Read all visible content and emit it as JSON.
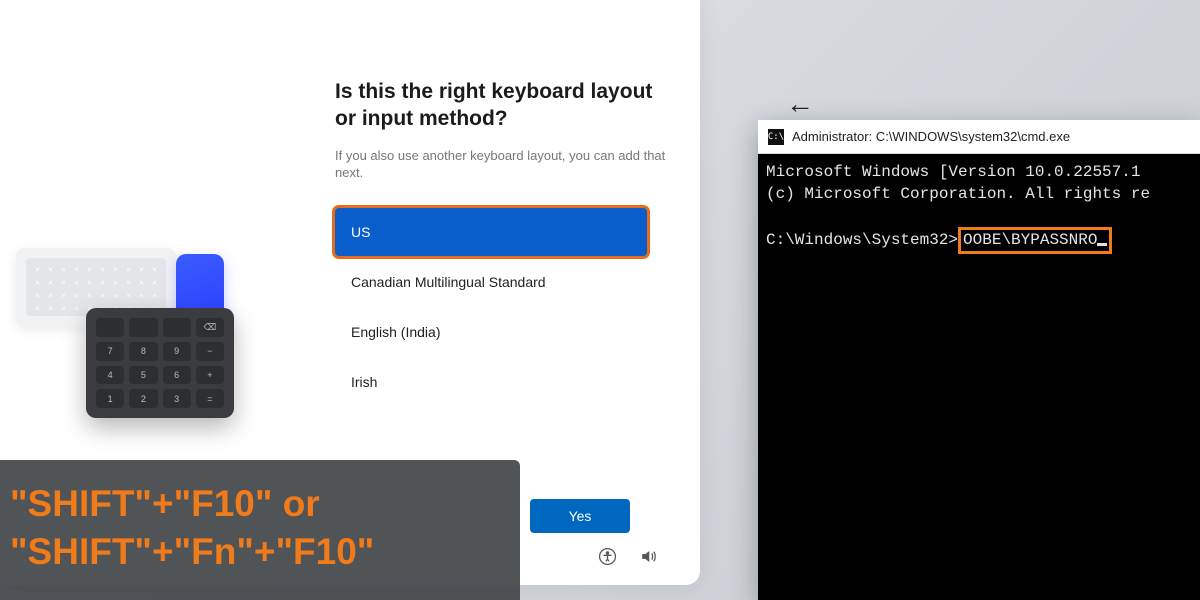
{
  "oobe": {
    "title": "Is this the right keyboard layout or input method?",
    "subtitle": "If you also use another keyboard layout, you can add that next.",
    "layouts": [
      "US",
      "Canadian Multilingual Standard",
      "English (India)",
      "Irish"
    ],
    "yes_label": "Yes"
  },
  "numpad_keys": [
    "",
    "",
    "",
    "⌫",
    "7",
    "8",
    "9",
    "−",
    "4",
    "5",
    "6",
    "+",
    "1",
    "2",
    "3",
    "="
  ],
  "cmd": {
    "title": "Administrator: C:\\WINDOWS\\system32\\cmd.exe",
    "line1": "Microsoft Windows [Version 10.0.22557.1",
    "line2": "(c) Microsoft Corporation. All rights re",
    "prompt": "C:\\Windows\\System32>",
    "command": "OOBE\\BYPASSNRO"
  },
  "back_arrow": "←",
  "caption_line1": "\"SHIFT\"+\"F10\" or",
  "caption_line2": "\"SHIFT\"+\"Fn\"+\"F10\"",
  "icons": {
    "accessibility": "accessibility-icon",
    "volume": "volume-icon"
  }
}
